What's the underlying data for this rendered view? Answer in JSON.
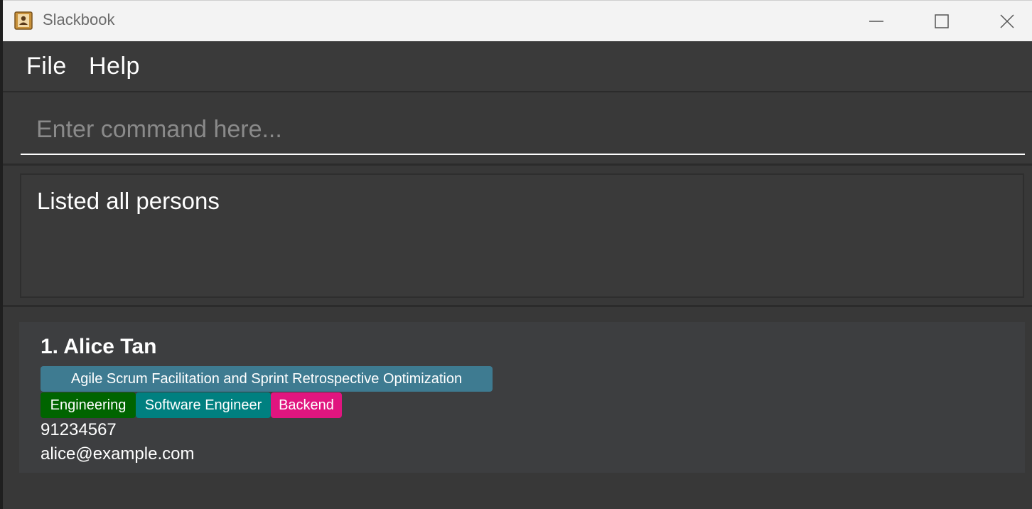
{
  "window": {
    "title": "Slackbook"
  },
  "icons": {
    "app": "address-book-icon",
    "minimize": "minimize-icon",
    "maximize": "maximize-icon",
    "close": "close-icon"
  },
  "menu": {
    "items": [
      {
        "label": "File"
      },
      {
        "label": "Help"
      }
    ]
  },
  "command": {
    "placeholder": "Enter command here...",
    "value": ""
  },
  "result": {
    "message": "Listed all persons"
  },
  "persons": [
    {
      "name": "1. Alice Tan",
      "skill_tag": "Agile Scrum Facilitation and Sprint Retrospective Optimization",
      "tags": [
        "Engineering",
        "Software Engineer",
        "Backend"
      ],
      "phone": "91234567",
      "email": "alice@example.com"
    }
  ],
  "colors": {
    "skill_tag": "#3e7b91",
    "department_tag": "#006400",
    "role_tag": "#008080",
    "team_tag": "#e0157f",
    "background": "#383838",
    "card": "#3d3e40"
  }
}
